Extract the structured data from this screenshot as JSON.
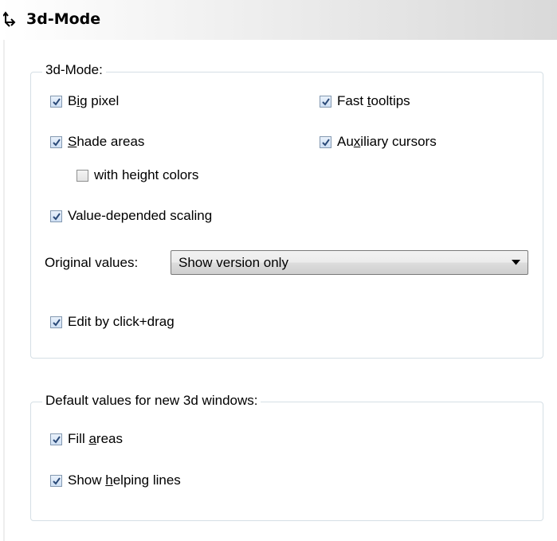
{
  "header": {
    "title": "3d-Mode",
    "icon": "3d-axes-icon"
  },
  "group_3d": {
    "legend": "3d-Mode:",
    "checkboxes": {
      "big_pixel": {
        "pre": "B",
        "ul": "i",
        "post": "g pixel",
        "checked": true
      },
      "fast_tooltips": {
        "pre": "Fast ",
        "ul": "t",
        "post": "ooltips",
        "checked": true
      },
      "shade_areas": {
        "pre": "",
        "ul": "S",
        "post": "hade areas",
        "checked": true
      },
      "auxiliary_cursors": {
        "pre": "Au",
        "ul": "x",
        "post": "iliary cursors",
        "checked": true
      },
      "height_colors": {
        "pre": "with height colors",
        "ul": "",
        "post": "",
        "checked": false
      },
      "value_scaling": {
        "pre": "Value-depended scaling",
        "ul": "",
        "post": "",
        "checked": true
      },
      "edit_drag": {
        "pre": "Edit by click+drag",
        "ul": "",
        "post": "",
        "checked": true
      }
    },
    "original_values": {
      "label": "Original values:",
      "selected": "Show version only"
    }
  },
  "group_defaults": {
    "legend": "Default values for new 3d windows:",
    "checkboxes": {
      "fill_areas": {
        "pre": "Fill ",
        "ul": "a",
        "post": "reas",
        "checked": true
      },
      "helping_lines": {
        "pre": "Show ",
        "ul": "h",
        "post": "elping lines",
        "checked": true
      }
    }
  },
  "colors": {
    "check_mark": "#2b4a78",
    "group_border": "#d5dfe5",
    "header_gradient_end": "#d9d9d9"
  }
}
